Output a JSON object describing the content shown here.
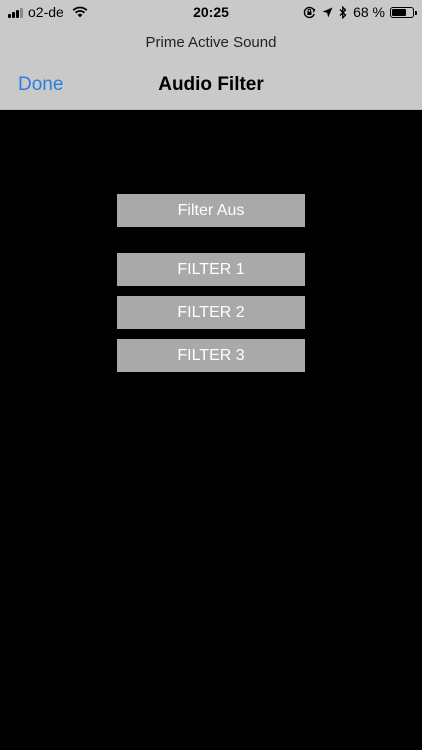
{
  "status_bar": {
    "carrier": "o2-de",
    "time": "20:25",
    "battery_percent": "68 %",
    "battery_level": 0.68,
    "icons": [
      "signal-icon",
      "wifi-icon",
      "orientation-lock-icon",
      "location-icon",
      "bluetooth-icon",
      "battery-icon"
    ]
  },
  "app": {
    "name": "Prime Active Sound"
  },
  "nav": {
    "done_label": "Done",
    "title": "Audio Filter",
    "accent_color": "#2f7de1"
  },
  "filters": {
    "off_label": "Filter Aus",
    "items": [
      "FILTER 1",
      "FILTER 2",
      "FILTER 3"
    ],
    "button_color": "#a9a9a9"
  }
}
